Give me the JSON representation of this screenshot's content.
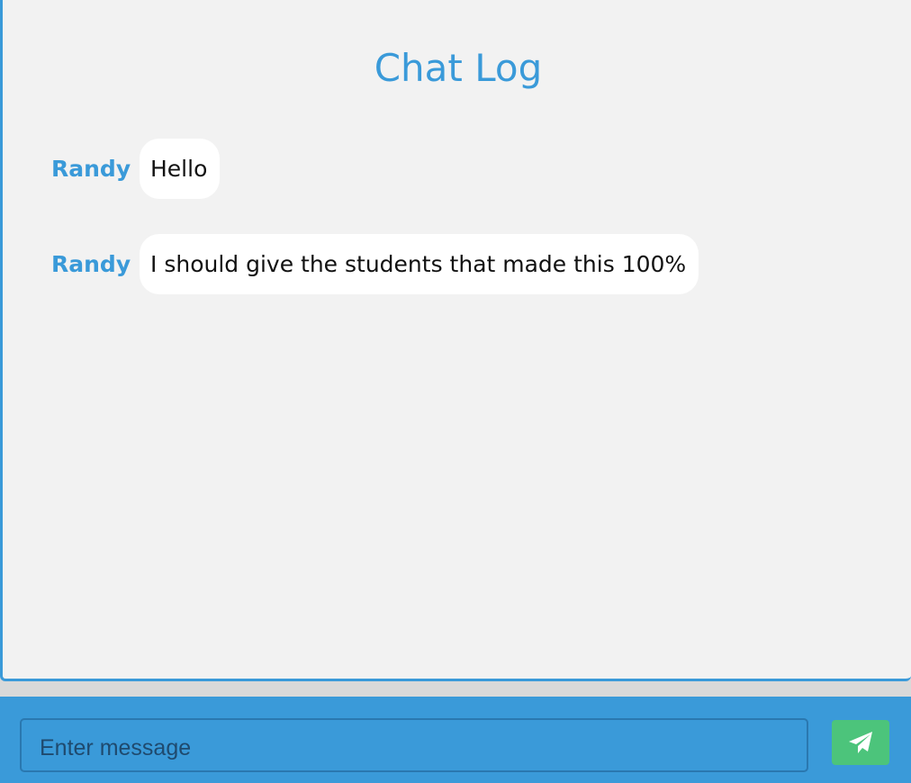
{
  "chat": {
    "title": "Chat Log",
    "messages": [
      {
        "sender": "Randy",
        "text": "Hello"
      },
      {
        "sender": "Randy",
        "text": "I should give the students that made this 100%"
      }
    ]
  },
  "composer": {
    "placeholder": "Enter message",
    "send_icon": "paper-plane-icon"
  },
  "colors": {
    "accent": "#3a9ad9",
    "panel_bg": "#f2f2f2",
    "bubble_bg": "#ffffff",
    "send_button": "#4cc47b"
  }
}
